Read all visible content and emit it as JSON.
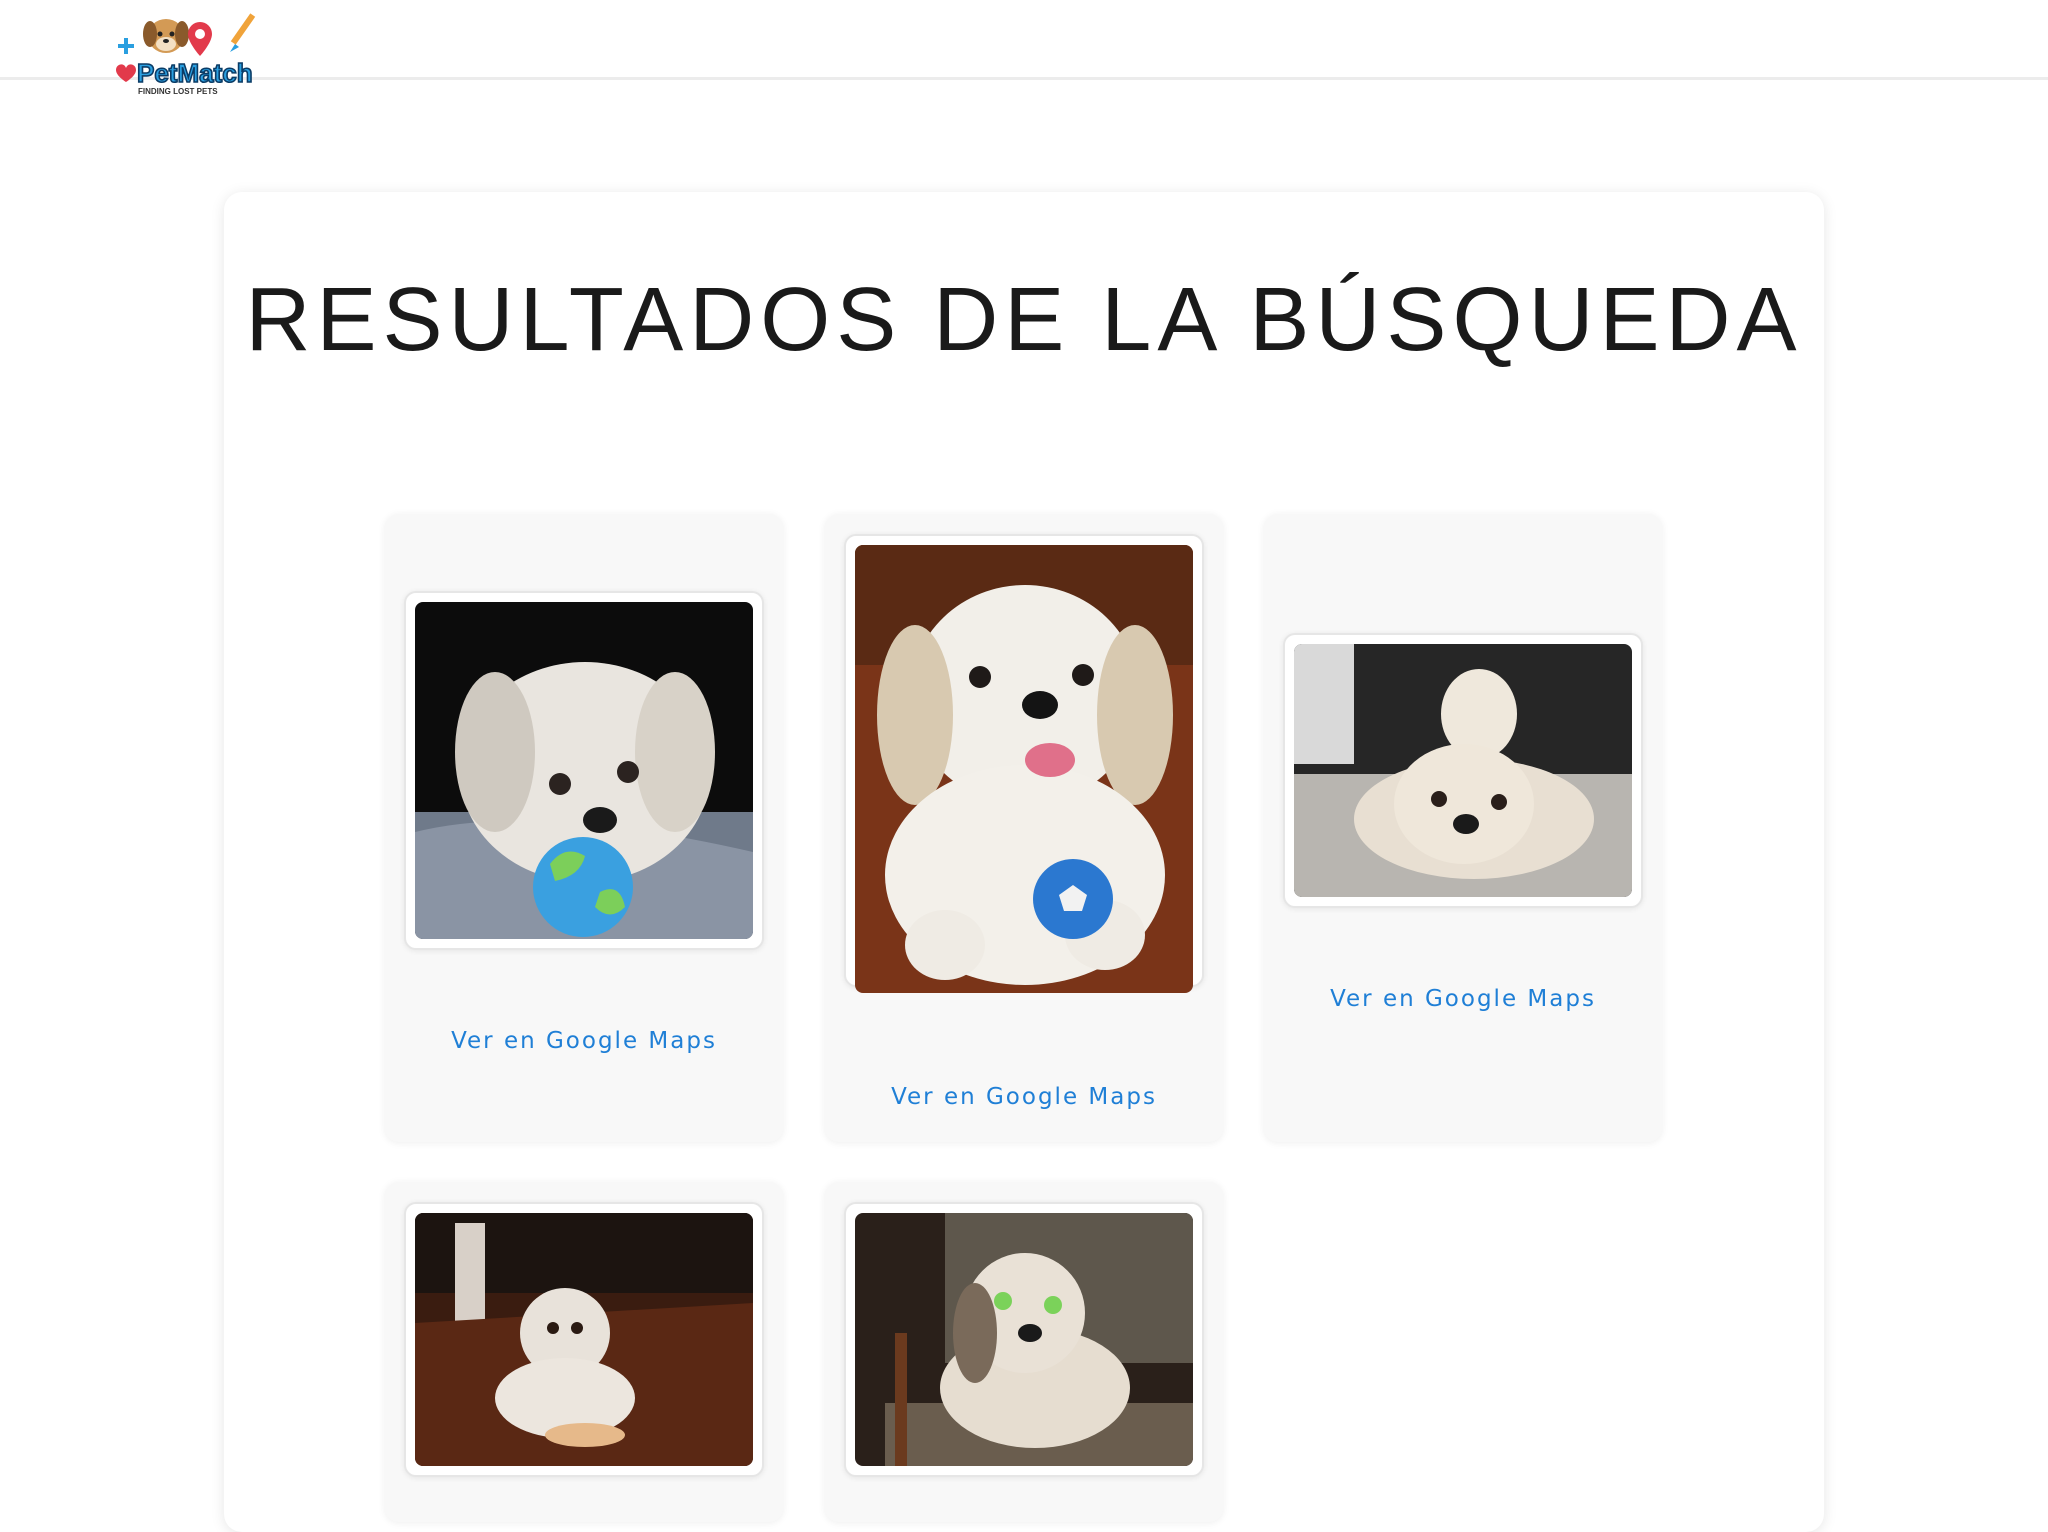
{
  "header": {
    "logo": {
      "brand_text": "PetMatch",
      "tagline": "FINDING LOST PETS"
    }
  },
  "main": {
    "title": "RESULTADOS DE LA BÚSQUEDA",
    "results": [
      {
        "map_link_label": "Ver en Google Maps"
      },
      {
        "map_link_label": "Ver en Google Maps"
      },
      {
        "map_link_label": "Ver en Google Maps"
      },
      {
        "map_link_label": ""
      },
      {
        "map_link_label": ""
      }
    ]
  },
  "colors": {
    "link": "#1f7fd6",
    "logo_blue": "#2a9fe0",
    "logo_red": "#e23a4b"
  }
}
